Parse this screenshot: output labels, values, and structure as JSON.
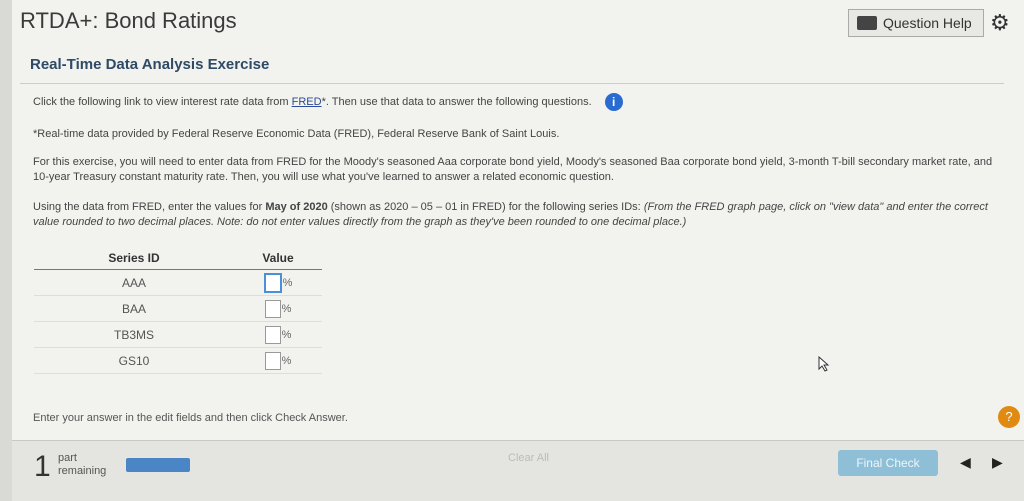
{
  "header": {
    "title": "RTDA+: Bond Ratings",
    "question_help": "Question Help"
  },
  "subtitle": "Real-Time Data Analysis Exercise",
  "intro": {
    "before_link": "Click the following link to view interest rate data from ",
    "link": "FRED",
    "after_link": "*. Then use that data to answer the following questions."
  },
  "footnote": "*Real-time data provided by Federal Reserve Economic Data (FRED), Federal Reserve Bank of Saint Louis.",
  "exercise_text": "For this exercise, you will need to enter data from FRED for the Moody's seasoned Aaa corporate bond yield, Moody's seasoned Baa corporate bond yield, 3-month T-bill secondary market rate, and 10-year Treasury constant maturity rate. Then, you will use what you've learned to answer a related economic question.",
  "instructions": {
    "a": "Using the data from FRED, enter the values for ",
    "date_bold": "May of 2020",
    "b": " (shown as 2020 – 05 – 01 in FRED) for the following series IDs: ",
    "italic": "(From the FRED graph page, click on \"view data\" and enter the correct value rounded to two decimal places. Note: do not enter values directly from the graph as they've been rounded to one decimal place.)"
  },
  "table": {
    "headers": [
      "Series ID",
      "Value"
    ],
    "rows": [
      {
        "series": "AAA",
        "value": "",
        "unit": "%"
      },
      {
        "series": "BAA",
        "value": "",
        "unit": "%"
      },
      {
        "series": "TB3MS",
        "value": "",
        "unit": "%"
      },
      {
        "series": "GS10",
        "value": "",
        "unit": "%"
      }
    ]
  },
  "enter_note": "Enter your answer in the edit fields and then click Check Answer.",
  "footer": {
    "part_count": "1",
    "part_label_1": "part",
    "part_label_2": "remaining",
    "progress": 1.0,
    "clear_all": "Clear All",
    "final_check": "Final Check"
  },
  "colors": {
    "accent": "#2a6bd1",
    "progress": "#4a86c5",
    "final_check": "#8fbfd7",
    "help": "#e08a12"
  }
}
